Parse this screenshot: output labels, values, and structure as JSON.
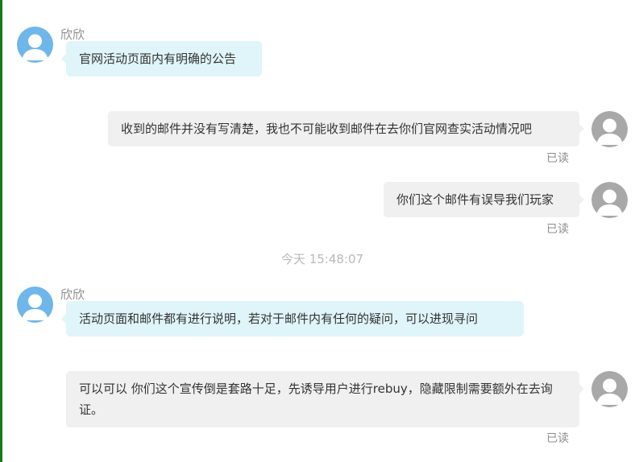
{
  "colors": {
    "incoming_bubble": "#e0f5f9",
    "outgoing_bubble": "#f0f0f0",
    "incoming_avatar": "#6fb6ea",
    "outgoing_avatar": "#a8a8a8",
    "left_rule": "#1a7a1a"
  },
  "messages": [
    {
      "direction": "incoming",
      "sender": "欣欣",
      "text": "官网活动页面内有明确的公告",
      "avatar_icon": "user-avatar-icon"
    },
    {
      "direction": "outgoing",
      "text": "收到的邮件并没有写清楚，我也不可能收到邮件在去你们官网查实活动情况吧",
      "status": "已读",
      "avatar_icon": "user-avatar-icon"
    },
    {
      "direction": "outgoing",
      "text": "你们这个邮件有误导我们玩家",
      "status": "已读",
      "avatar_icon": "user-avatar-icon"
    },
    {
      "direction": "divider",
      "text": "今天 15:48:07"
    },
    {
      "direction": "incoming",
      "sender": "欣欣",
      "text": "活动页面和邮件都有进行说明，若对于邮件内有任何的疑问，可以进现寻问",
      "avatar_icon": "user-avatar-icon"
    },
    {
      "direction": "outgoing",
      "text": "可以可以 你们这个宣传倒是套路十足，先诱导用户进行rebuy，隐藏限制需要额外在去询证。",
      "status": "已读",
      "avatar_icon": "user-avatar-icon"
    }
  ]
}
